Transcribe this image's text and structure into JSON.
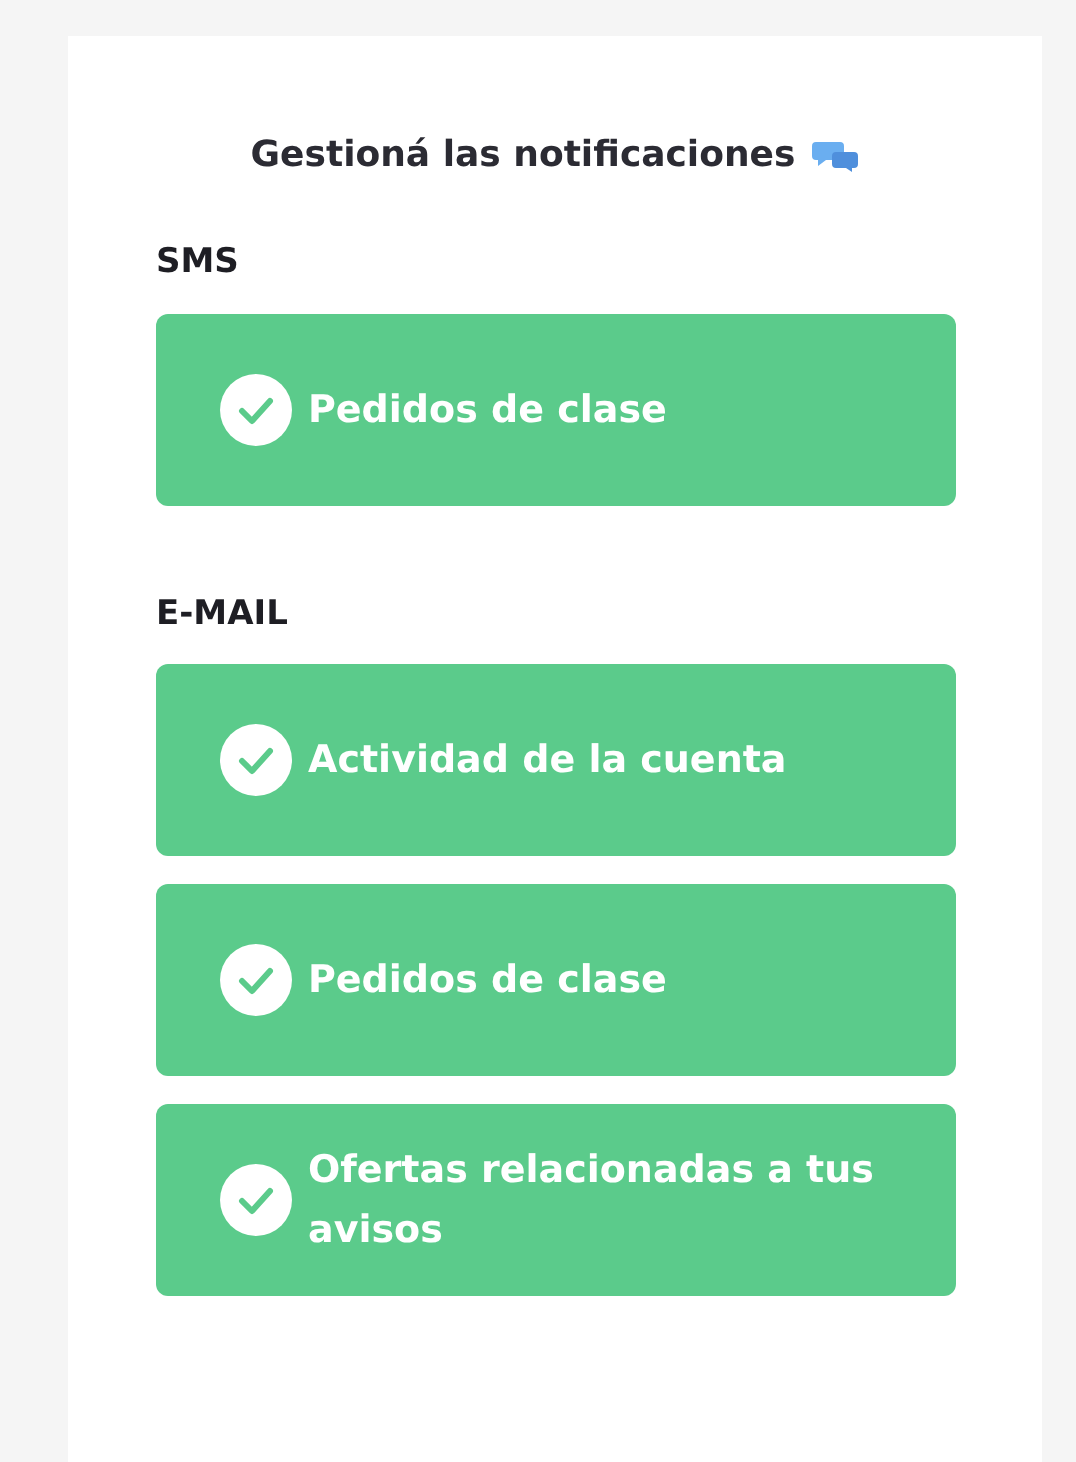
{
  "title": "Gestioná las notificaciones",
  "sections": [
    {
      "label": "SMS",
      "options": [
        {
          "label": "Pedidos de clase",
          "checked": true
        }
      ]
    },
    {
      "label": "E-MAIL",
      "options": [
        {
          "label": "Actividad de la cuenta",
          "checked": true
        },
        {
          "label": "Pedidos de clase",
          "checked": true
        },
        {
          "label": "Ofertas relacionadas a tus avisos",
          "checked": true
        }
      ]
    }
  ]
}
